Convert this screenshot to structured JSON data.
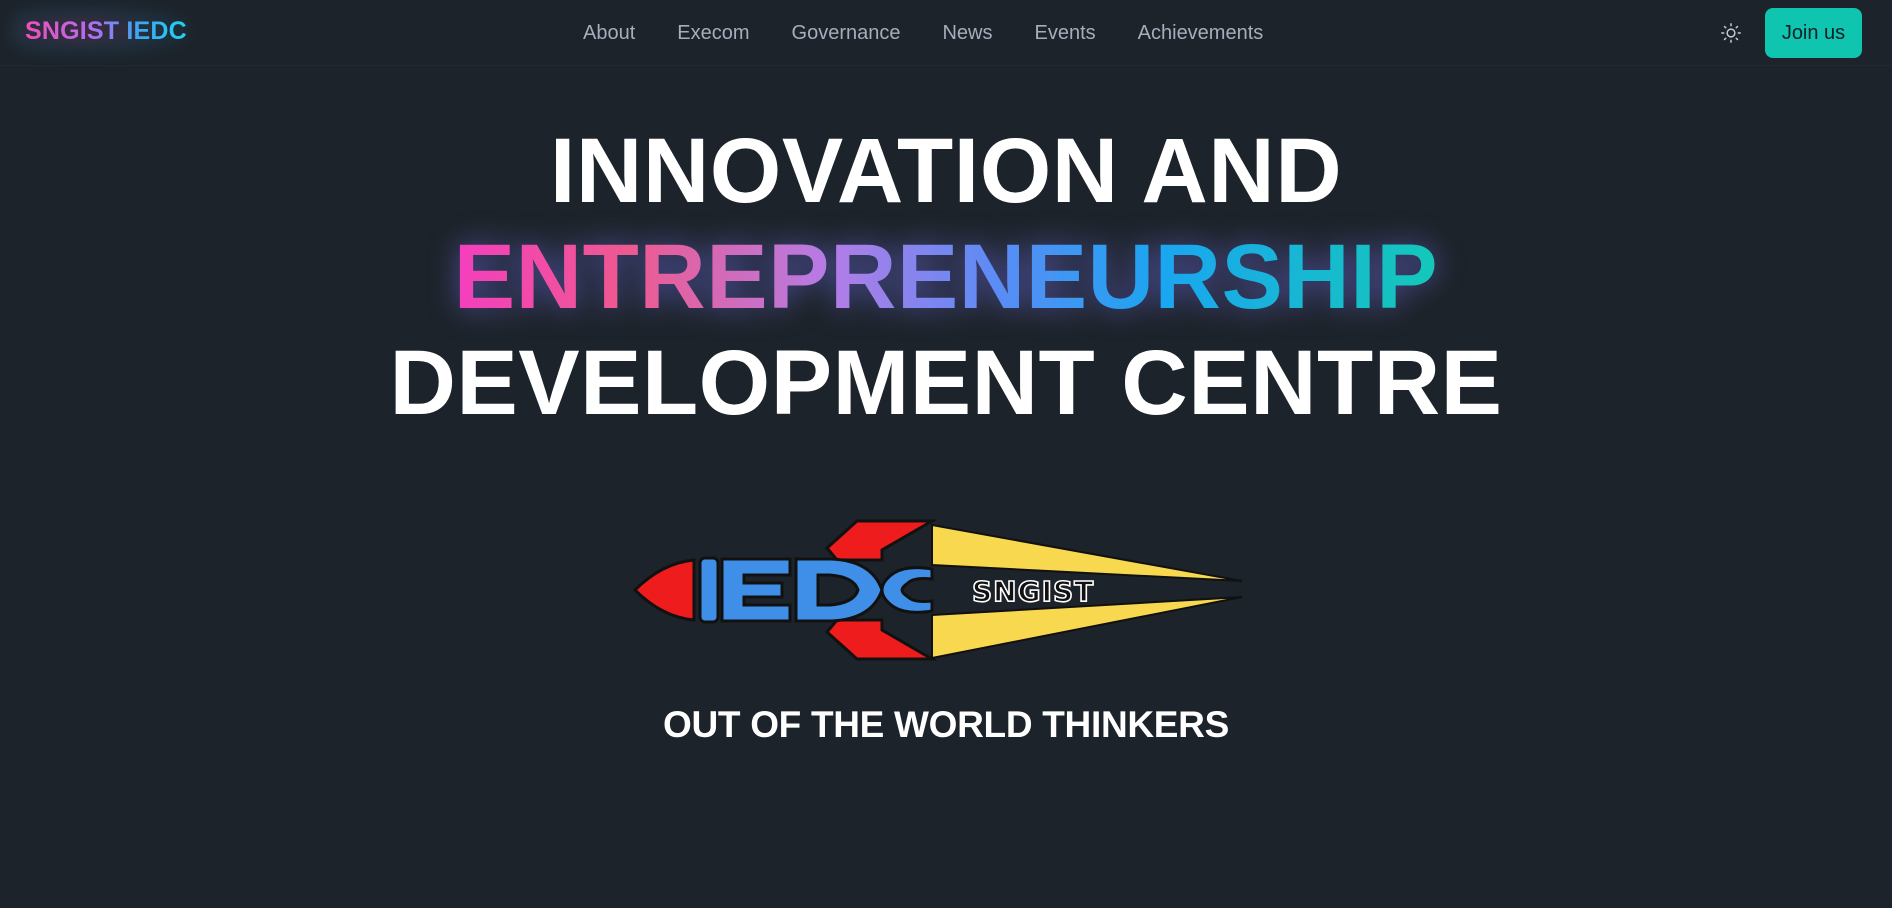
{
  "navbar": {
    "brand": "SNGIST IEDC",
    "links": [
      "About",
      "Execom",
      "Governance",
      "News",
      "Events",
      "Achievements"
    ],
    "theme_toggle_icon": "sun-icon",
    "join_label": "Join us"
  },
  "hero": {
    "line1": "INNOVATION AND",
    "line2": "ENTREPRENEURSHIP",
    "line3": "DEVELOPMENT CENTRE"
  },
  "logo": {
    "text": "SNGIST",
    "mark": "IEDC",
    "icon": "rocket-logo"
  },
  "tagline": "OUT OF THE WORLD THINKERS",
  "colors": {
    "background": "#1d232a",
    "accent": "#0fc5b0",
    "nav_text": "#a6adbb",
    "gradient_start": "#f43fbe",
    "gradient_mid": "#5b8cf5",
    "gradient_end": "#14c8b8"
  }
}
